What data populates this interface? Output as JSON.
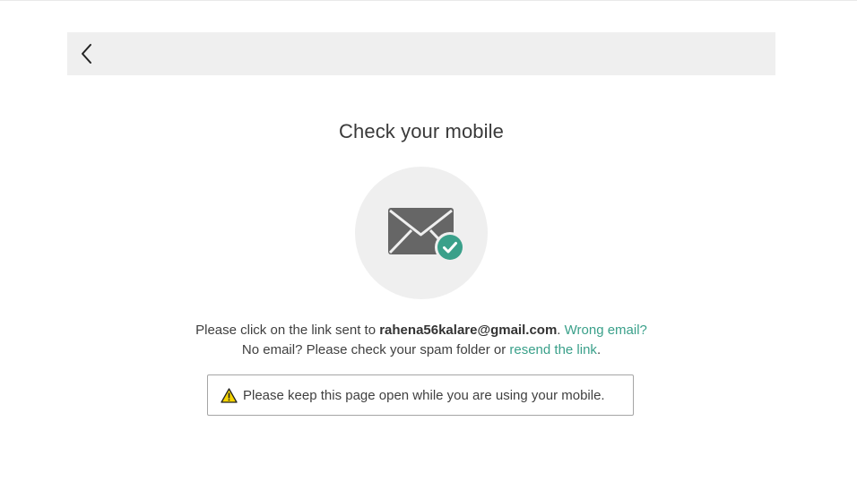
{
  "header": {
    "back_icon": "chevron-left-icon"
  },
  "main": {
    "title": "Check your mobile",
    "illustration": {
      "icon": "envelope-icon",
      "badge_icon": "check-circle-icon",
      "badge_color": "#3aa08a",
      "envelope_color": "#666666",
      "circle_color": "#efefef"
    },
    "line1": {
      "prefix": "Please click on the link sent to ",
      "email": "rahena56kalare@gmail.com",
      "separator": ".",
      "wrong_email_link": "Wrong email?"
    },
    "line2": {
      "prefix": "No email? Please check your spam folder or ",
      "resend_link": "resend the link",
      "suffix": "."
    },
    "notice": {
      "icon": "warning-icon",
      "text": "Please keep this page open while you are using your mobile."
    }
  },
  "colors": {
    "accent": "#3aa08a",
    "header_background": "#efefef",
    "warning": "#f5d400"
  }
}
